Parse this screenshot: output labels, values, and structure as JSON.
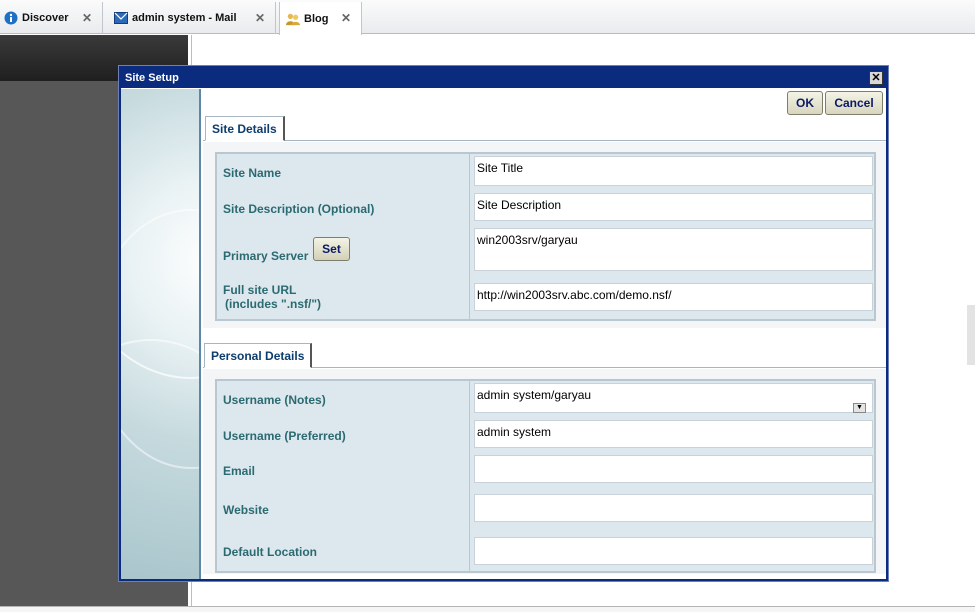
{
  "tabs": [
    {
      "label": "Discover",
      "icon": "info-icon"
    },
    {
      "label": "admin system - Mail",
      "icon": "mail-icon"
    },
    {
      "label": "Blog",
      "icon": "blog-people-icon",
      "active": true
    }
  ],
  "dialog": {
    "title": "Site Setup",
    "ok_label": "OK",
    "cancel_label": "Cancel"
  },
  "site_details": {
    "tab_label": "Site Details",
    "site_name_label": "Site Name",
    "site_name_value": "Site Title",
    "site_desc_label": "Site Description (Optional)",
    "site_desc_value": "Site Description",
    "primary_server_label": "Primary Server",
    "set_label": "Set",
    "primary_server_value": "win2003srv/garyau",
    "full_url_label_1": "Full site URL",
    "full_url_label_2": "(includes \".nsf/\")",
    "full_url_value": "http://win2003srv.abc.com/demo.nsf/"
  },
  "personal_details": {
    "tab_label": "Personal Details",
    "username_notes_label": "Username (Notes)",
    "username_notes_value": "admin system/garyau",
    "username_pref_label": "Username (Preferred)",
    "username_pref_value": "admin system",
    "email_label": "Email",
    "email_value": "",
    "website_label": "Website",
    "website_value": "",
    "location_label": "Default Location",
    "location_value": ""
  },
  "colors": {
    "title_bar": "#0b2b7e",
    "label_text": "#2a6a70",
    "left_pane": "#575757"
  }
}
